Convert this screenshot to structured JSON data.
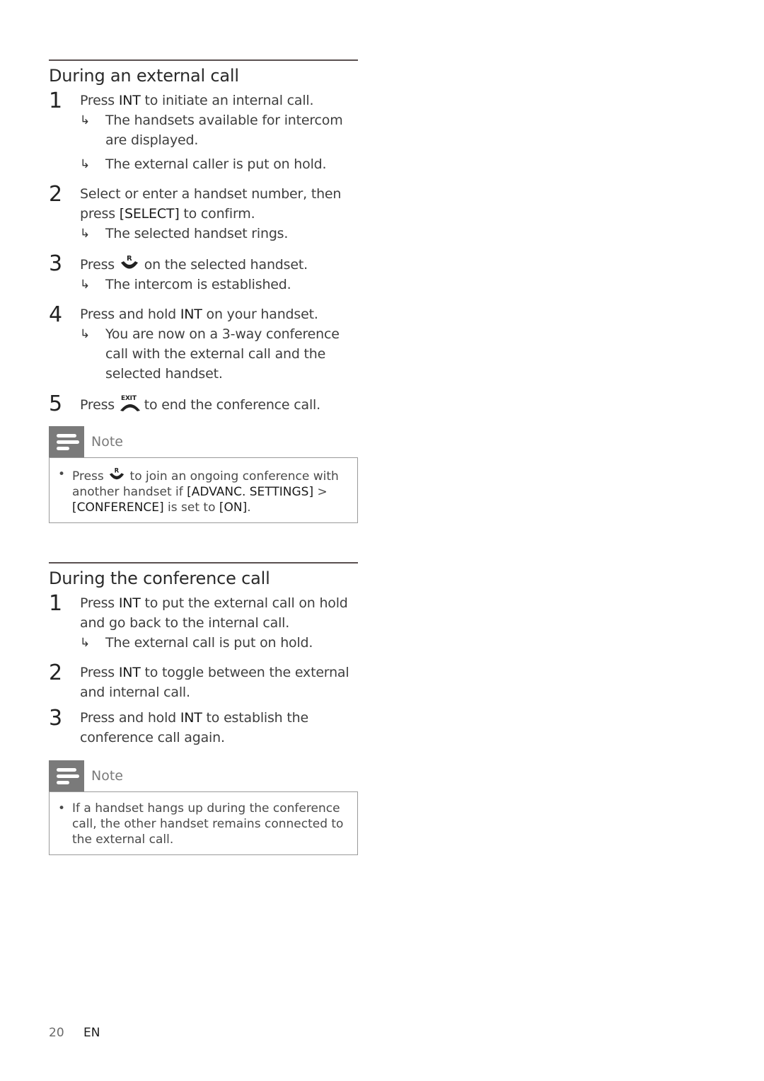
{
  "section1": {
    "title": "During an external call",
    "steps": [
      {
        "num": "1",
        "pre": "Press ",
        "key": "INT",
        "post": " to initiate an internal call.",
        "results": [
          "The handsets available for intercom are displayed.",
          "The external caller is put on hold."
        ]
      },
      {
        "num": "2",
        "line1": "Select or enter a handset number, then",
        "pre": "press ",
        "key": "[SELECT]",
        "post": " to confirm.",
        "results": [
          "The selected handset rings."
        ]
      },
      {
        "num": "3",
        "pre": "Press ",
        "icon": "talk-r-icon",
        "post": " on the selected handset.",
        "results": [
          "The intercom is established."
        ]
      },
      {
        "num": "4",
        "pre": "Press and hold ",
        "key": "INT",
        "post": " on your handset.",
        "results": [
          "You are now on a 3-way conference call with the external call and the selected handset."
        ]
      },
      {
        "num": "5",
        "pre": "Press ",
        "icon": "end-call-exit-icon",
        "post": " to end the conference call."
      }
    ],
    "note": {
      "label": "Note",
      "pre": "Press ",
      "post": " to join an ongoing conference with another handset if ",
      "key1": "[ADVANC. SETTINGS]",
      "sep": " > ",
      "key2": "[CONFERENCE]",
      "mid": " is set to ",
      "key3": "[ON]",
      "end": "."
    }
  },
  "section2": {
    "title": "During the conference call",
    "steps": [
      {
        "num": "1",
        "pre": "Press ",
        "key": "INT",
        "post": " to put the external call on hold and go back to the internal call.",
        "results": [
          "The external call is put on hold."
        ]
      },
      {
        "num": "2",
        "pre": "Press ",
        "key": "INT",
        "post": " to toggle between the external and internal call."
      },
      {
        "num": "3",
        "pre": "Press and hold ",
        "key": "INT",
        "post": " to establish the conference call again."
      }
    ],
    "note": {
      "label": "Note",
      "text": "If a handset hangs up during the conference call, the other handset remains connected to the external call."
    }
  },
  "footer": {
    "page": "20",
    "lang": "EN"
  },
  "icons": {
    "result_arrow": "↳"
  }
}
